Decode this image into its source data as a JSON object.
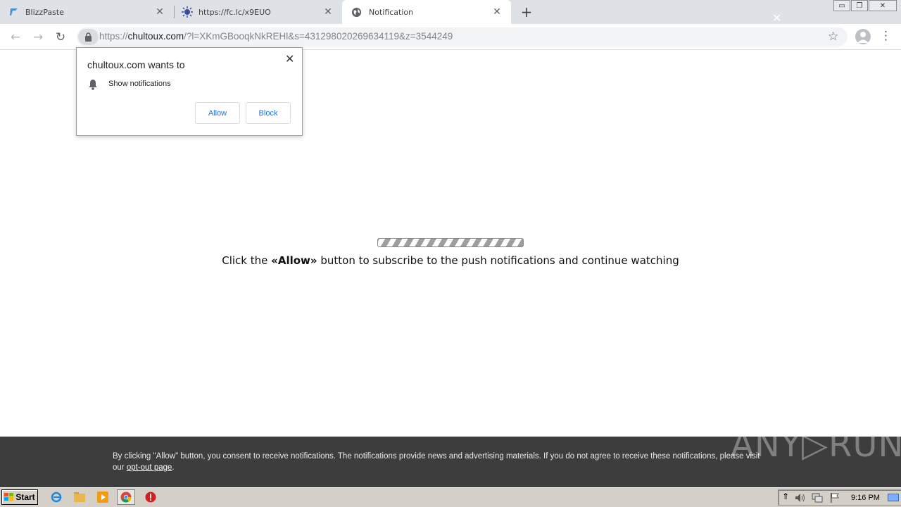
{
  "tabs": [
    {
      "title": "BlizzPaste",
      "icon": "blizzpaste-icon",
      "active": false
    },
    {
      "title": "https://fc.lc/x9EUO",
      "icon": "virus-icon",
      "active": false
    },
    {
      "title": "Notification",
      "icon": "globe-icon",
      "active": true
    }
  ],
  "tab_close_glyph": "✕",
  "new_tab_glyph": "+",
  "window_controls": {
    "minimize": "▭",
    "restore": "❐",
    "close": "✕"
  },
  "toolbar": {
    "back_glyph": "←",
    "forward_glyph": "→",
    "reload_glyph": "↻",
    "star_glyph": "☆",
    "menu_glyph": "⋮"
  },
  "address": {
    "scheme": "https://",
    "host": "chultoux.com",
    "path": "/?l=XKmGBooqkNkREHl&s=431298020269634119&z=3544249"
  },
  "permission_prompt": {
    "title": "chultoux.com wants to",
    "permission": "Show notifications",
    "allow_label": "Allow",
    "block_label": "Block",
    "close_glyph": "✕"
  },
  "page": {
    "instruction_before": "Click the ",
    "instruction_bold": "«Allow»",
    "instruction_after": " button to subscribe to the push notifications and continue watching"
  },
  "consent": {
    "text_before": "By clicking \"Allow\" button, you consent to receive notifications. The notifications provide news and advertising materials. If you do not agree to receive these notifications, please visit our ",
    "link_label": "opt-out page",
    "text_after": ".",
    "close_glyph": "✕"
  },
  "watermark": "ANY▷RUN",
  "taskbar": {
    "start_label": "Start",
    "clock": "9:16 PM",
    "tray_up_glyph": "⇑"
  },
  "colors": {
    "tab_strip": "#dee1e6",
    "accent_blue": "#1a73e8",
    "consent_bar": "#3d3d3d",
    "taskbar": "#d4d0c8"
  }
}
